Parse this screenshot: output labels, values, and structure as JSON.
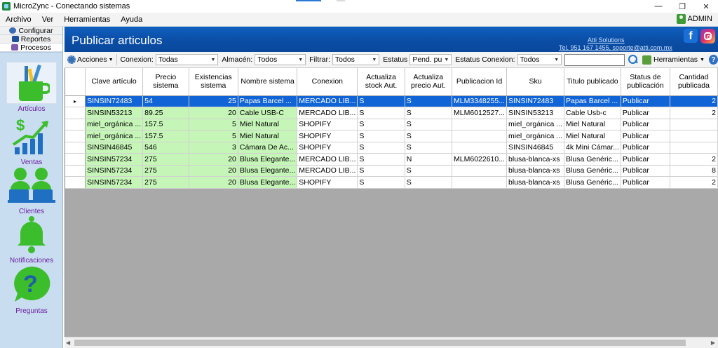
{
  "window": {
    "title": "MicroZync - Conectando sistemas",
    "controls": {
      "minimize": "—",
      "maximize": "❐",
      "close": "✕"
    }
  },
  "menu": {
    "items": [
      "Archivo",
      "Ver",
      "Herramientas",
      "Ayuda"
    ],
    "user": "ADMIN"
  },
  "nav": {
    "top_buttons": [
      {
        "label": "Configurar",
        "icon": "gear-icon",
        "color": "#3b6cb3"
      },
      {
        "label": "Reportes",
        "icon": "report-icon",
        "color": "#1f4f9a"
      },
      {
        "label": "Procesos",
        "icon": "process-icon",
        "color": "#7b5bb0"
      }
    ],
    "modules": [
      {
        "label": "Artículos",
        "icon": "articles-icon"
      },
      {
        "label": "Ventas",
        "icon": "sales-chart-icon"
      },
      {
        "label": "Clientes",
        "icon": "clients-icon"
      },
      {
        "label": "Notificaciones",
        "icon": "bell-icon"
      },
      {
        "label": "Preguntas",
        "icon": "question-icon"
      }
    ],
    "accent_color": "#3cbd2c"
  },
  "header": {
    "title": "Publicar articulos",
    "company": "Atti Solutions",
    "contact": "Tel. 951 167 1455, soporte@atti.com.mx",
    "brand_color": "#0b4ea6"
  },
  "toolbar": {
    "actions_label": "Acciones",
    "filters": [
      {
        "label": "Conexion:",
        "value": "Todas"
      },
      {
        "label": "Almacén:",
        "value": "Todos"
      },
      {
        "label": "Filtrar:",
        "value": "Todos"
      },
      {
        "label": "Estatus",
        "value": "Pend. publica"
      },
      {
        "label": "Estatus Conexion:",
        "value": "Todos"
      }
    ],
    "search_value": "",
    "tools_label": "Herramientas",
    "help_label": "?"
  },
  "grid": {
    "columns": [
      "Clave artículo",
      "Precio sistema",
      "Existencias sistema",
      "Nombre sistema",
      "Conexion",
      "Actualiza stock Aut.",
      "Actualiza precio Aut.",
      "Publicacion Id",
      "Sku",
      "Titulo publicado",
      "Status de publicación",
      "Cantidad publicada"
    ],
    "selected_row": 0,
    "row_marker": "▸",
    "rows": [
      [
        "SINSIN72483",
        "54",
        "25",
        "Papas Barcel ...",
        "MERCADO LIB...",
        "S",
        "S",
        "MLM3348255...",
        "SINSIN72483",
        "Papas Barcel ...",
        "Publicar",
        "2"
      ],
      [
        "SINSIN53213",
        "89.25",
        "20",
        "Cable USB-C",
        "MERCADO LIB...",
        "S",
        "S",
        "MLM6012527...",
        "SINSIN53213",
        "Cable Usb-c",
        "Publicar",
        "2"
      ],
      [
        "miel_orgánica ...",
        "157.5",
        "5",
        "Miel Natural",
        "SHOPIFY",
        "S",
        "S",
        "",
        "miel_orgánica ...",
        "Miel Natural",
        "Publicar",
        ""
      ],
      [
        "miel_orgánica ...",
        "157.5",
        "5",
        "Miel Natural",
        "SHOPIFY",
        "S",
        "S",
        "",
        "miel_orgánica ...",
        "Miel Natural",
        "Publicar",
        ""
      ],
      [
        "SINSIN46845",
        "546",
        "3",
        "Cámara De Ac...",
        "SHOPIFY",
        "S",
        "S",
        "",
        "SINSIN46845",
        "4k Mini Cámar...",
        "Publicar",
        ""
      ],
      [
        "SINSIN57234",
        "275",
        "20",
        "Blusa Elegante...",
        "MERCADO LIB...",
        "S",
        "N",
        "MLM6022610...",
        "blusa-blanca-xs",
        "Blusa Genéric...",
        "Publicar",
        "2"
      ],
      [
        "SINSIN57234",
        "275",
        "20",
        "Blusa Elegante...",
        "MERCADO LIB...",
        "S",
        "S",
        "",
        "blusa-blanca-xs",
        "Blusa Genéric...",
        "Publicar",
        "8"
      ],
      [
        "SINSIN57234",
        "275",
        "20",
        "Blusa Elegante...",
        "SHOPIFY",
        "S",
        "S",
        "",
        "blusa-blanca-xs",
        "Blusa Genéric...",
        "Publicar",
        "2"
      ]
    ],
    "row_highlight_color": "#c6f5b8",
    "selected_color": "#1064d6"
  }
}
